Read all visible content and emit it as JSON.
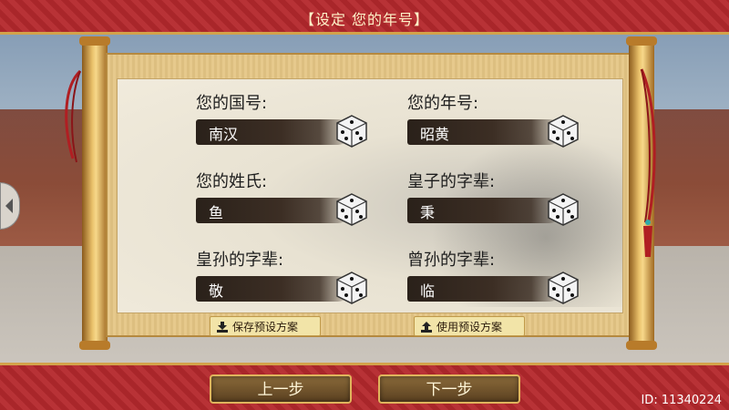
{
  "header": {
    "title": "【设定 您的年号】"
  },
  "fields": [
    {
      "label": "您的国号:",
      "value": "南汉"
    },
    {
      "label": "您的年号:",
      "value": "昭黄"
    },
    {
      "label": "您的姓氏:",
      "value": "鱼"
    },
    {
      "label": "皇子的字辈:",
      "value": "秉"
    },
    {
      "label": "皇孙的字辈:",
      "value": "敬"
    },
    {
      "label": "曾孙的字辈:",
      "value": "临"
    }
  ],
  "presets": {
    "save_label": "保存预设方案",
    "use_label": "使用预设方案"
  },
  "nav": {
    "prev_label": "上一步",
    "next_label": "下一步"
  },
  "footer": {
    "id_text": "ID: 11340224"
  },
  "icons": {
    "randomize": "dice-icon",
    "save": "download-icon",
    "use": "upload-icon",
    "side": "expand-icon"
  },
  "colors": {
    "banner_red": "#a9262a",
    "gold": "#d3a24a",
    "ink": "#2a211a"
  }
}
